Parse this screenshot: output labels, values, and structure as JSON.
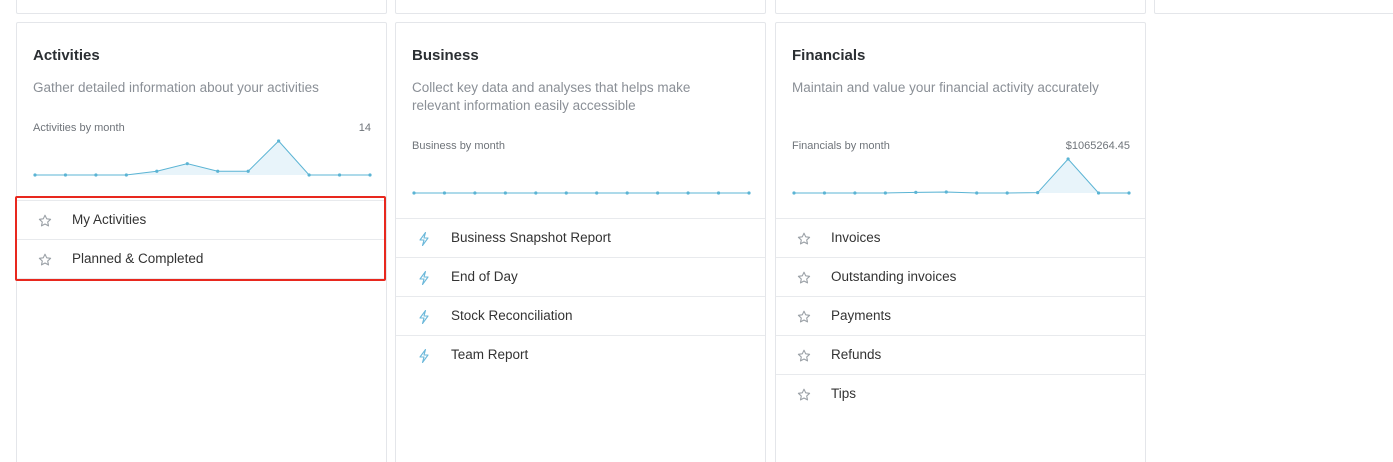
{
  "cards": [
    {
      "title": "Activities",
      "description": "Gather detailed information about your activities",
      "sparkline_label": "Activities by month",
      "sparkline_value": "14",
      "items": [
        {
          "label": "My Activities",
          "icon": "star-icon"
        },
        {
          "label": "Planned & Completed",
          "icon": "star-icon"
        }
      ]
    },
    {
      "title": "Business",
      "description": "Collect key data and analyses that helps make relevant information easily accessible",
      "sparkline_label": "Business by month",
      "sparkline_value": "",
      "items": [
        {
          "label": "Business Snapshot Report",
          "icon": "lightning-icon"
        },
        {
          "label": "End of Day",
          "icon": "lightning-icon"
        },
        {
          "label": "Stock Reconciliation",
          "icon": "lightning-icon"
        },
        {
          "label": "Team Report",
          "icon": "lightning-icon"
        }
      ]
    },
    {
      "title": "Financials",
      "description": "Maintain and value your financial activity accurately",
      "sparkline_label": "Financials by month",
      "sparkline_value": "$1065264.45",
      "items": [
        {
          "label": "Invoices",
          "icon": "star-icon"
        },
        {
          "label": "Outstanding invoices",
          "icon": "star-icon"
        },
        {
          "label": "Payments",
          "icon": "star-icon"
        },
        {
          "label": "Refunds",
          "icon": "star-icon"
        },
        {
          "label": "Tips",
          "icon": "star-icon"
        }
      ]
    }
  ],
  "colors": {
    "sparkline": "#5bb4d4",
    "sparkline_fill": "#e8f4fa",
    "highlight": "#e8281e",
    "icon": "#9aa0a6",
    "lightning": "#6bb8da"
  },
  "chart_data": [
    {
      "type": "area",
      "x": [
        1,
        2,
        3,
        4,
        5,
        6,
        7,
        8,
        9,
        10,
        11,
        12
      ],
      "values": [
        0,
        0,
        0,
        0,
        1,
        3,
        1,
        1,
        9,
        0,
        0,
        0
      ]
    },
    {
      "type": "area",
      "x": [
        1,
        2,
        3,
        4,
        5,
        6,
        7,
        8,
        9,
        10,
        11,
        12
      ],
      "values": [
        0,
        0,
        0,
        0,
        0,
        0,
        0,
        0,
        0,
        0,
        0,
        0
      ]
    },
    {
      "type": "area",
      "x": [
        1,
        2,
        3,
        4,
        5,
        6,
        7,
        8,
        9,
        10,
        11,
        12
      ],
      "values": [
        0,
        0,
        0,
        0,
        20000,
        30000,
        0,
        0,
        10000,
        1000000,
        0,
        0
      ]
    }
  ]
}
